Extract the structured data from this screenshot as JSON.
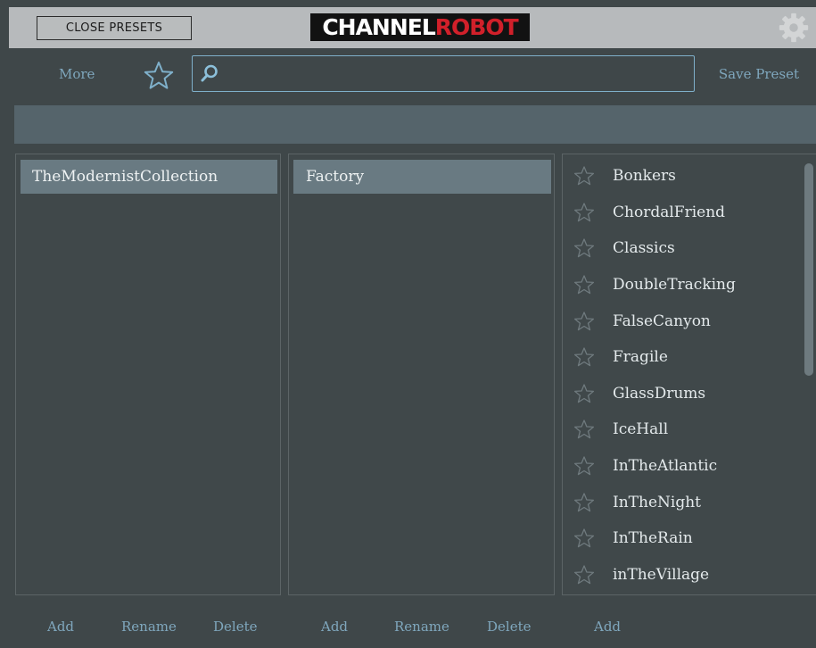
{
  "topbar": {
    "close_label": "CLOSE PRESETS",
    "logo_white": "CHANNEL",
    "logo_red": "ROBOT"
  },
  "toolbar": {
    "more_label": "More",
    "save_label": "Save Preset",
    "search_value": "",
    "search_placeholder": ""
  },
  "banks": {
    "selected": "TheModernistCollection",
    "footer": {
      "add": "Add",
      "rename": "Rename",
      "delete": "Delete"
    }
  },
  "categories": {
    "selected": "Factory",
    "footer": {
      "add": "Add",
      "rename": "Rename",
      "delete": "Delete"
    }
  },
  "presets": {
    "items": [
      "Bonkers",
      "ChordalFriend",
      "Classics",
      "DoubleTracking",
      "FalseCanyon",
      "Fragile",
      "GlassDrums",
      "IceHall",
      "InTheAtlantic",
      "InTheNight",
      "InTheRain",
      "inTheVillage"
    ],
    "footer": {
      "add": "Add"
    }
  },
  "colors": {
    "accent": "#7fa7bd",
    "logo_red": "#d1202a",
    "selection": "#697a82",
    "background": "#3f4749",
    "topbar": "#b7babc"
  },
  "icons": {
    "settings": "gear-icon",
    "favorites": "star-outline-icon",
    "search": "search-icon",
    "preset_favorite": "star-outline-icon"
  }
}
